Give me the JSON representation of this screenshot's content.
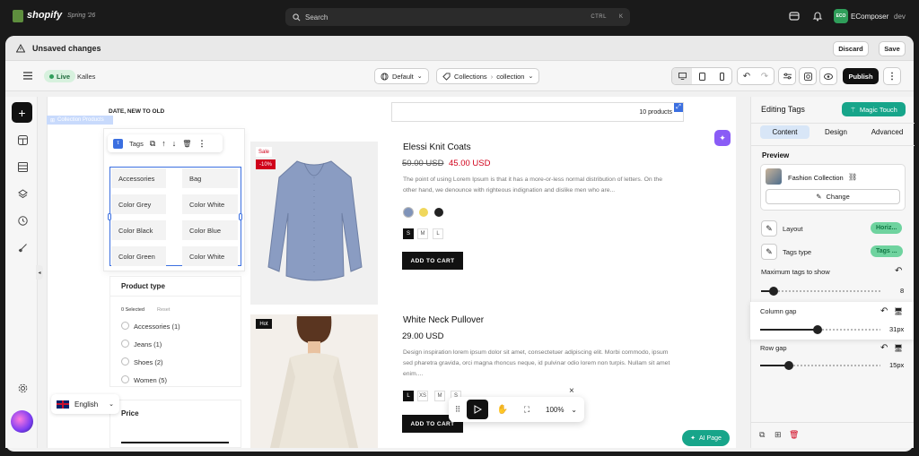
{
  "topbar": {
    "brand": "shopify",
    "edition": "Spring '26",
    "search_placeholder": "Search",
    "shortcut_key1": "CTRL",
    "shortcut_key2": "K",
    "store_badge": "ECO",
    "store_name": "EComposer",
    "store_env": "dev"
  },
  "unsaved": {
    "title": "Unsaved changes",
    "discard_label": "Discard",
    "save_label": "Save"
  },
  "toolbar": {
    "live_label": "Live",
    "theme_name": "Kalles",
    "template_label": "Default",
    "page_prefix": "Collections",
    "page_name": "collection",
    "publish_label": "Publish"
  },
  "canvas": {
    "sort_label": "DATE, NEW TO OLD",
    "section_tag": "Collection Products",
    "product_count": "10 products",
    "tags_toolbar_label": "Tags",
    "tags": [
      {
        "label": "Accessories"
      },
      {
        "label": "Bag"
      },
      {
        "label": "Color Grey"
      },
      {
        "label": "Color White"
      },
      {
        "label": "Color Black"
      },
      {
        "label": "Color Blue"
      },
      {
        "label": "Color Green"
      },
      {
        "label": "Color White"
      }
    ],
    "filter": {
      "title": "Product type",
      "selected": "0 Selected",
      "reset": "Reset",
      "options": [
        {
          "label": "Accessories (1)"
        },
        {
          "label": "Jeans (1)"
        },
        {
          "label": "Shoes (2)"
        },
        {
          "label": "Women (5)"
        }
      ],
      "price_title": "Price"
    },
    "products": [
      {
        "badge1": "Sale",
        "badge2": "-10%",
        "title": "Elessi Knit Coats",
        "old_price": "50.00 USD",
        "price": "45.00 USD",
        "description": "The point of using Lorem Ipsum is that it has a more-or-less normal distribution of letters. On the other hand, we denounce with righteous indignation and dislike men who are...",
        "swatches": [
          "#7f93b9",
          "#f0d75c",
          "#222222"
        ],
        "sizes": [
          "S",
          "M",
          "L"
        ],
        "cart_label": "ADD TO CART"
      },
      {
        "badge1": "Hot",
        "title": "White Neck Pullover",
        "price": "29.00 USD",
        "description": "Design inspiration lorem ipsum dolor sit amet, consectetuer adipiscing elit. Morbi commodo, ipsum sed pharetra gravida, orci magna rhoncus neque, id pulvinar odio lorem non turpis. Nullam sit amet enim....",
        "sizes": [
          "L",
          "XS",
          "M",
          "S"
        ],
        "cart_label": "ADD TO CART"
      }
    ],
    "zoom_label": "100%",
    "ai_page_label": "AI Page",
    "language": "English"
  },
  "panel": {
    "title": "Editing Tags",
    "magic_label": "Magic Touch",
    "tabs": [
      {
        "label": "Content"
      },
      {
        "label": "Design"
      },
      {
        "label": "Advanced"
      }
    ],
    "preview_title": "Preview",
    "preview_name": "Fashion Collection",
    "change_label": "Change",
    "layout_label": "Layout",
    "layout_value": "Horiz...",
    "tags_type_label": "Tags type",
    "tags_type_value": "Tags ...",
    "max_tags_label": "Maximum tags to show",
    "max_tags_value": "8",
    "max_tags_fraction": 0.1,
    "column_gap_label": "Column gap",
    "column_gap_value": "31px",
    "column_gap_fraction": 0.48,
    "row_gap_label": "Row gap",
    "row_gap_value": "15px",
    "row_gap_fraction": 0.23
  },
  "colors": {
    "accent_green": "#6fd39f",
    "magic_teal": "#17a58a",
    "sale_red": "#d0021b",
    "selection_blue": "#3b6fe0"
  }
}
